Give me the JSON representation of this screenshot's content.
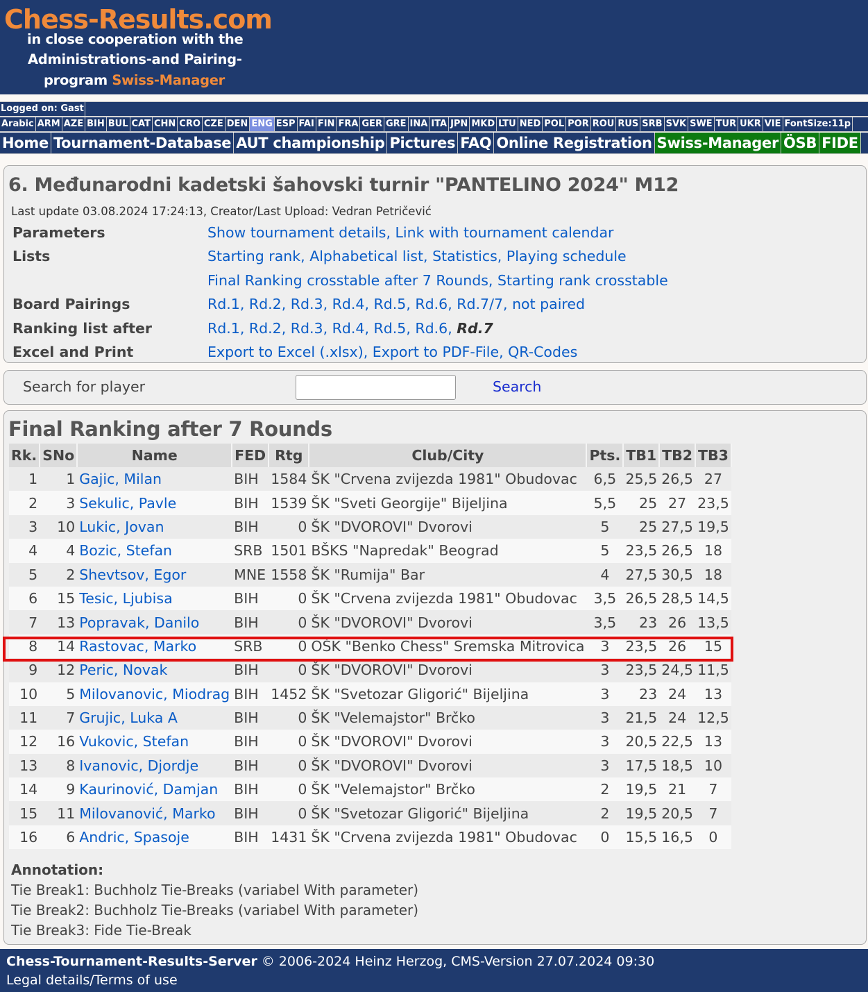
{
  "header": {
    "logo_title": "Chess-Results.com",
    "logo_line1": "in close cooperation with the",
    "logo_line2": "Administrations-and Pairing-",
    "logo_line3_prefix": "program ",
    "logo_line3_brand": "Swiss-Manager"
  },
  "login": {
    "text": "Logged on: Gast"
  },
  "languages": {
    "items": [
      "Arabic",
      "ARM",
      "AZE",
      "BIH",
      "BUL",
      "CAT",
      "CHN",
      "CRO",
      "CZE",
      "DEN",
      "ENG",
      "ESP",
      "FAI",
      "FIN",
      "FRA",
      "GER",
      "GRE",
      "INA",
      "ITA",
      "JPN",
      "MKD",
      "LTU",
      "NED",
      "POL",
      "POR",
      "ROU",
      "RUS",
      "SRB",
      "SVK",
      "SWE",
      "TUR",
      "UKR",
      "VIE",
      "FontSize:11p"
    ],
    "active": "ENG"
  },
  "nav": {
    "items": [
      {
        "label": "Home",
        "green": false
      },
      {
        "label": "Tournament-Database",
        "green": false
      },
      {
        "label": "AUT championship",
        "green": false
      },
      {
        "label": "Pictures",
        "green": false
      },
      {
        "label": "FAQ",
        "green": false
      },
      {
        "label": "Online Registration",
        "green": false
      },
      {
        "label": "Swiss-Manager",
        "green": true
      },
      {
        "label": "ÖSB",
        "green": true
      },
      {
        "label": "FIDE",
        "green": true
      }
    ]
  },
  "tournament": {
    "title": "6. Međunarodni kadetski šahovski turnir \"PANTELINO 2024\" M12",
    "last_update": "Last update 03.08.2024 17:24:13, Creator/Last Upload: Vedran Petričević",
    "rows": [
      {
        "label": "Parameters",
        "links": [
          "Show tournament details",
          "Link with tournament calendar"
        ]
      },
      {
        "label": "Lists",
        "links": [
          "Starting rank",
          "Alphabetical list",
          "Statistics",
          "Playing schedule"
        ]
      },
      {
        "label": "",
        "links": [
          "Final Ranking crosstable after 7 Rounds",
          "Starting rank crosstable"
        ]
      },
      {
        "label": "Board Pairings",
        "links": [
          "Rd.1",
          "Rd.2",
          "Rd.3",
          "Rd.4",
          "Rd.5",
          "Rd.6",
          "Rd.7/7",
          " not paired"
        ]
      },
      {
        "label": "Ranking list after",
        "links": [
          "Rd.1",
          "Rd.2",
          "Rd.3",
          "Rd.4",
          "Rd.5",
          "Rd.6"
        ],
        "current": "Rd.7"
      },
      {
        "label": "Excel and Print",
        "links": [
          "Export to Excel (.xlsx)",
          "Export to PDF-File",
          "QR-Codes"
        ]
      }
    ]
  },
  "search": {
    "label": "Search for player",
    "input_value": "",
    "button_label": "Search"
  },
  "ranking": {
    "title": "Final Ranking after 7 Rounds",
    "columns": [
      "Rk.",
      "SNo",
      "Name",
      "FED",
      "Rtg",
      "Club/City",
      "Pts.",
      "TB1",
      "TB2",
      "TB3"
    ],
    "rows": [
      [
        "1",
        "1",
        "Gajic, Milan",
        "BIH",
        "1584",
        "ŠK \"Crvena zvijezda 1981\" Obudovac",
        "6,5",
        "25,5",
        "26,5",
        "27"
      ],
      [
        "2",
        "3",
        "Sekulic, Pavle",
        "BIH",
        "1539",
        "ŠK \"Sveti Georgije\" Bijeljina",
        "5,5",
        "25",
        "27",
        "23,5"
      ],
      [
        "3",
        "10",
        "Lukic, Jovan",
        "BIH",
        "0",
        "ŠK \"DVOROVI\" Dvorovi",
        "5",
        "25",
        "27,5",
        "19,5"
      ],
      [
        "4",
        "4",
        "Bozic, Stefan",
        "SRB",
        "1501",
        "BŠKS \"Napredak\" Beograd",
        "5",
        "23,5",
        "26,5",
        "18"
      ],
      [
        "5",
        "2",
        "Shevtsov, Egor",
        "MNE",
        "1558",
        "ŠK \"Rumija\" Bar",
        "4",
        "27,5",
        "30,5",
        "18"
      ],
      [
        "6",
        "15",
        "Tesic, Ljubisa",
        "BIH",
        "0",
        "ŠK \"Crvena zvijezda 1981\" Obudovac",
        "3,5",
        "26,5",
        "28,5",
        "14,5"
      ],
      [
        "7",
        "13",
        "Popravak, Danilo",
        "BIH",
        "0",
        "ŠK \"DVOROVI\" Dvorovi",
        "3,5",
        "23",
        "26",
        "13,5"
      ],
      [
        "8",
        "14",
        "Rastovac, Marko",
        "SRB",
        "0",
        "OŠK \"Benko Chess\" Sremska Mitrovica",
        "3",
        "23,5",
        "26",
        "15"
      ],
      [
        "9",
        "12",
        "Peric, Novak",
        "BIH",
        "0",
        "ŠK \"DVOROVI\" Dvorovi",
        "3",
        "23,5",
        "24,5",
        "11,5"
      ],
      [
        "10",
        "5",
        "Milovanovic, Miodrag",
        "BIH",
        "1452",
        "ŠK \"Svetozar Gligorić\" Bijeljina",
        "3",
        "23",
        "24",
        "13"
      ],
      [
        "11",
        "7",
        "Grujic, Luka A",
        "BIH",
        "0",
        "ŠK \"Velemajstor\" Brčko",
        "3",
        "21,5",
        "24",
        "12,5"
      ],
      [
        "12",
        "16",
        "Vukovic, Stefan",
        "BIH",
        "0",
        "ŠK \"DVOROVI\" Dvorovi",
        "3",
        "20,5",
        "22,5",
        "13"
      ],
      [
        "13",
        "8",
        "Ivanovic, Djordje",
        "BIH",
        "0",
        "ŠK \"DVOROVI\" Dvorovi",
        "3",
        "17,5",
        "18,5",
        "10"
      ],
      [
        "14",
        "9",
        "Kaurinović, Damjan",
        "BIH",
        "0",
        "ŠK \"Velemajstor\" Brčko",
        "2",
        "19,5",
        "21",
        "7"
      ],
      [
        "15",
        "11",
        "Milovanović, Marko",
        "BIH",
        "0",
        "ŠK \"Svetozar Gligorić\" Bijeljina",
        "2",
        "19,5",
        "20,5",
        "7"
      ],
      [
        "16",
        "6",
        "Andric, Spasoje",
        "BIH",
        "1431",
        "ŠK \"Crvena zvijezda 1981\" Obudovac",
        "0",
        "15,5",
        "16,5",
        "0"
      ]
    ],
    "highlighted_rank": "8"
  },
  "annotation": {
    "heading": "Annotation:",
    "lines": [
      "Tie Break1: Buchholz Tie-Breaks (variabel With parameter)",
      "Tie Break2: Buchholz Tie-Breaks (variabel With parameter)",
      "Tie Break3: Fide Tie-Break"
    ]
  },
  "footer": {
    "server_name": "Chess-Tournament-Results-Server",
    "copyright": " © 2006-2024 Heinz Herzog, CMS-Version 27.07.2024 09:30",
    "legal": "Legal details/Terms of use"
  },
  "colors": {
    "header_bg": "#1f3a6e",
    "logo_orange": "#f08a3a",
    "nav_green": "#0c7a10",
    "active_lang": "#7b8fe0",
    "link_blue": "#0a5cc7",
    "highlight_red": "#e01010"
  }
}
